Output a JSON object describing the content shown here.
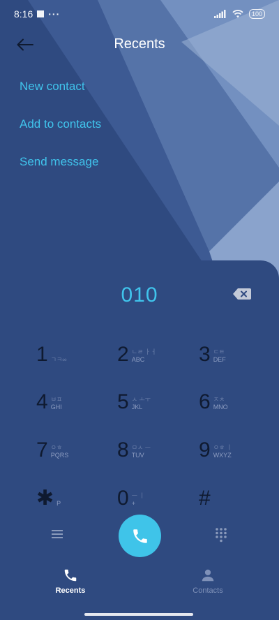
{
  "status_bar": {
    "time": "8:16",
    "more": "···",
    "battery": "100"
  },
  "header": {
    "title": "Recents",
    "back_icon": "arrow-left-icon"
  },
  "menu": {
    "items": [
      {
        "label": "New contact"
      },
      {
        "label": "Add to contacts"
      },
      {
        "label": "Send message"
      }
    ]
  },
  "dialer": {
    "number": "010",
    "backspace_icon": "backspace-icon",
    "keys": [
      {
        "digit": "1",
        "sub_top": "ㄱㅋ∞",
        "sub_bottom": ""
      },
      {
        "digit": "2",
        "sub_top": "ㄴㄹ ㅏㅓ",
        "sub_bottom": "ABC"
      },
      {
        "digit": "3",
        "sub_top": "ㄷㅌ",
        "sub_bottom": "DEF"
      },
      {
        "digit": "4",
        "sub_top": "ㅂㅍ",
        "sub_bottom": "GHI"
      },
      {
        "digit": "5",
        "sub_top": "ㅅ ㅗㅜ",
        "sub_bottom": "JKL"
      },
      {
        "digit": "6",
        "sub_top": "ㅈㅊ",
        "sub_bottom": "MNO"
      },
      {
        "digit": "7",
        "sub_top": "ㅇㅎ",
        "sub_bottom": "PQRS"
      },
      {
        "digit": "8",
        "sub_top": "ㅁㅅ ㅡ",
        "sub_bottom": "TUV"
      },
      {
        "digit": "9",
        "sub_top": "ㅇㅎ ㅣ",
        "sub_bottom": "WXYZ"
      },
      {
        "digit": "✱",
        "sub_top": "",
        "sub_bottom": "P"
      },
      {
        "digit": "0",
        "sub_top": "ㅡ ㅣ",
        "sub_bottom": "+"
      },
      {
        "digit": "#",
        "sub_top": "",
        "sub_bottom": ""
      }
    ]
  },
  "actions": {
    "menu_icon": "hamburger-icon",
    "call_icon": "phone-icon",
    "keypad_icon": "keypad-icon"
  },
  "bottom_nav": {
    "items": [
      {
        "label": "Recents",
        "icon": "phone-icon",
        "active": true
      },
      {
        "label": "Contacts",
        "icon": "person-icon",
        "active": false
      }
    ]
  },
  "colors": {
    "background": "#2f4a80",
    "accent": "#40c4ec",
    "call_button": "#3fc4e9",
    "digit": "#0f1a30"
  }
}
